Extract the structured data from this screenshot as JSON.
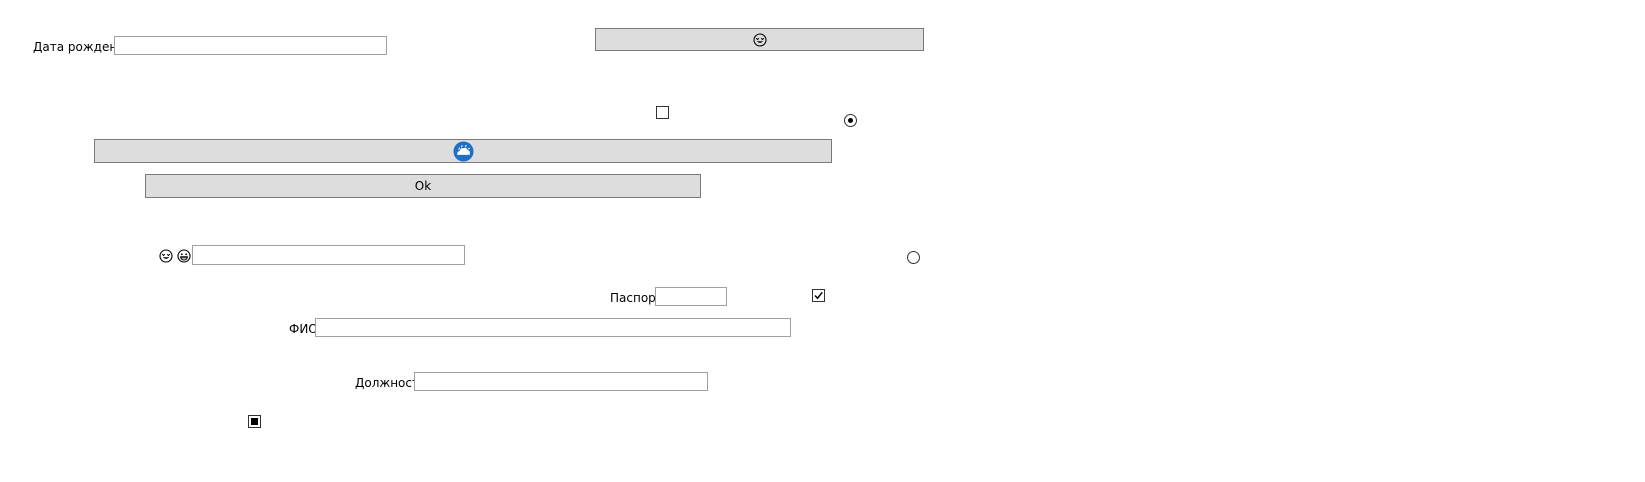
{
  "form": {
    "birth_date": {
      "label": "Дата рождения",
      "value": ""
    },
    "search": {
      "value": ""
    },
    "passport": {
      "label": "Паспорт",
      "value": ""
    },
    "fio": {
      "label": "ФИО",
      "value": ""
    },
    "position": {
      "label": "Должность",
      "value": ""
    }
  },
  "buttons": {
    "emoji_button_icon": "smiling-face-with-heart-eyes-icon",
    "cloud_button_icon": "cloud-icon",
    "ok_label": "Ok"
  },
  "controls": {
    "checkbox_top": {
      "checked": false
    },
    "radio_top": {
      "selected": true
    },
    "radio_bottom": {
      "selected": false
    },
    "checkbox_passport": {
      "checked": true
    },
    "checkbox_bottom": {
      "state": "indeterminate"
    }
  },
  "icons": {
    "emoji_a": "smiling-face-with-heart-eyes-icon",
    "emoji_b": "grinning-face-icon"
  },
  "colors": {
    "button_bg": "#dddddd",
    "cloud_blue": "#1e6fc7"
  }
}
